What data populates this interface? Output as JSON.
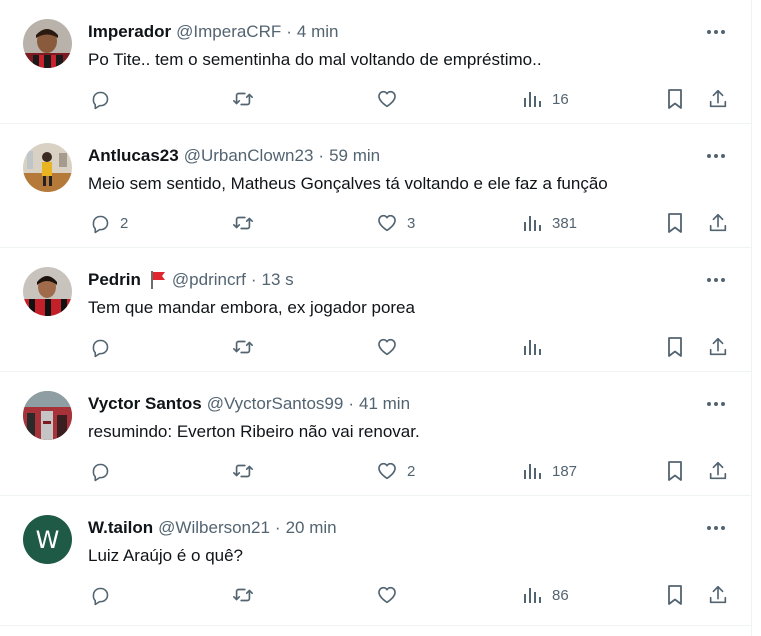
{
  "tweets": [
    {
      "name": "Imperador",
      "handle": "@ImperaCRF",
      "time": "4 min",
      "text": "Po Tite.. tem o sementinha do mal voltando de empréstimo..",
      "replies": "",
      "retweets": "",
      "likes": "",
      "views": "16",
      "avatar": "photo"
    },
    {
      "name": "Antlucas23",
      "handle": "@UrbanClown23",
      "time": "59 min",
      "text": "Meio sem sentido, Matheus Gonçalves tá voltando e ele faz a função",
      "replies": "2",
      "retweets": "",
      "likes": "3",
      "views": "381",
      "avatar": "photo"
    },
    {
      "name": "Pedrin",
      "handle": "@pdrincrf",
      "time": "13 s",
      "text": "Tem que mandar embora, ex jogador porea",
      "replies": "",
      "retweets": "",
      "likes": "",
      "views": "",
      "avatar": "photo",
      "flag_icon": "red-flag-icon"
    },
    {
      "name": "Vyctor Santos",
      "handle": "@VyctorSantos99",
      "time": "41 min",
      "text": "resumindo: Everton Ribeiro não vai renovar.",
      "replies": "",
      "retweets": "",
      "likes": "2",
      "views": "187",
      "avatar": "photo"
    },
    {
      "name": "W.tailon",
      "handle": "@Wilberson21",
      "time": "20 min",
      "text": "Luiz Araújo é o quê?",
      "replies": "",
      "retweets": "",
      "likes": "",
      "views": "86",
      "avatar": "letter",
      "avatar_letter": "W",
      "avatar_color": "#1e5a46"
    }
  ],
  "separator": "·",
  "colors": {
    "text": "#0f1419",
    "secondary": "#536471",
    "border": "#eff3f4"
  },
  "icons": [
    "more-icon",
    "reply-icon",
    "retweet-icon",
    "like-icon",
    "views-icon",
    "bookmark-icon",
    "share-icon"
  ]
}
